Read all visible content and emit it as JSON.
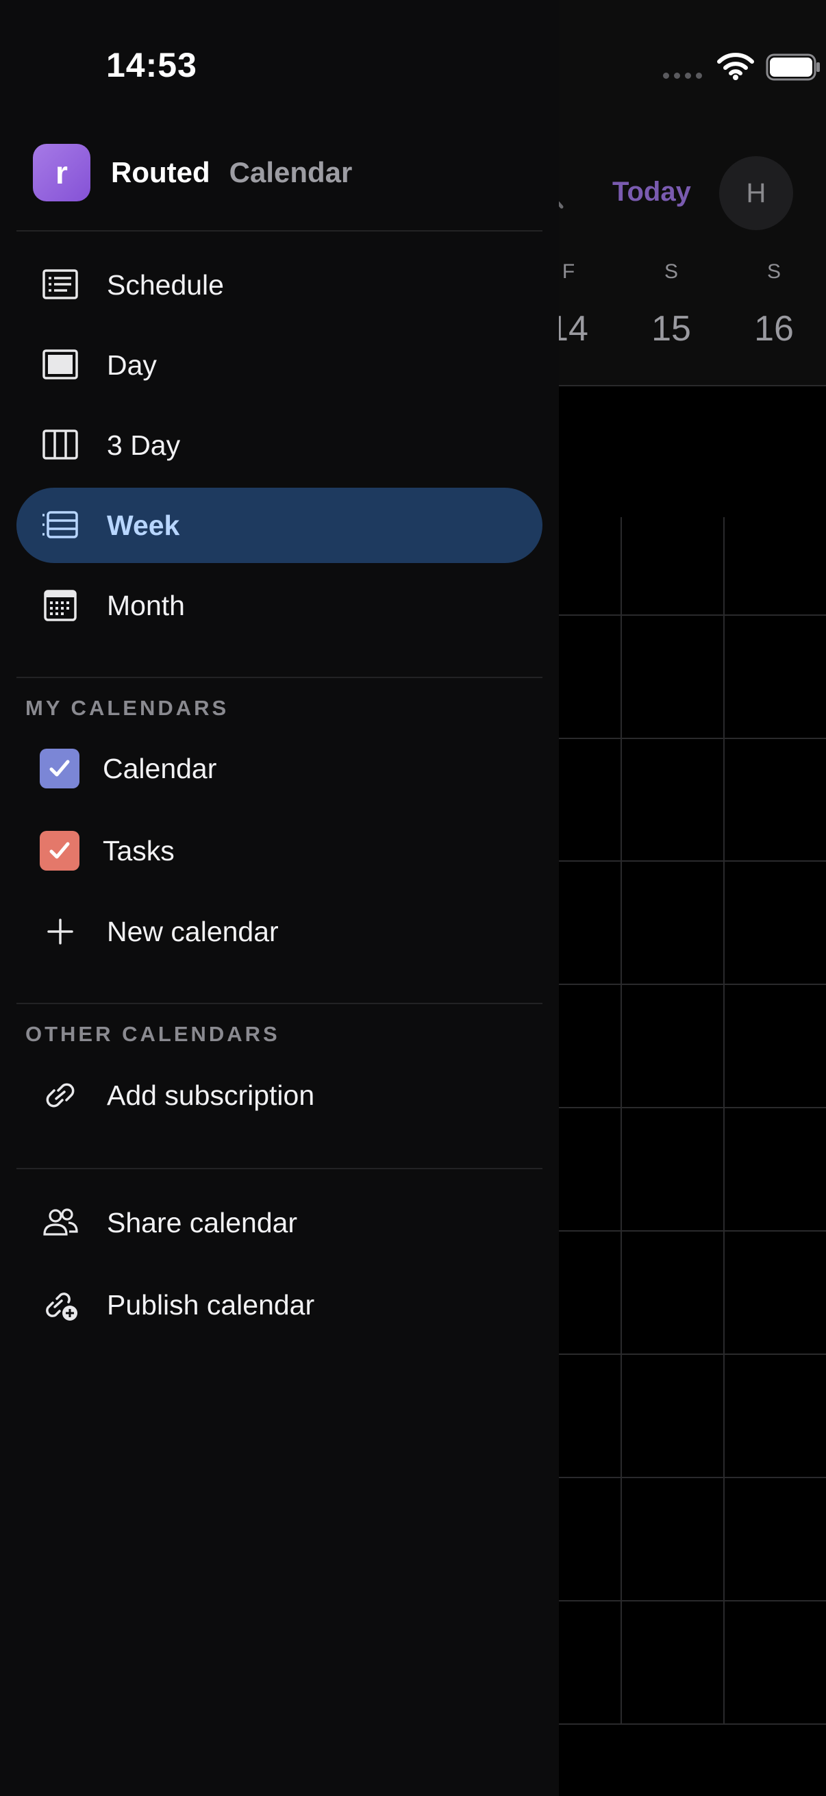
{
  "status_bar": {
    "time": "14:53"
  },
  "brand": {
    "logo_letter": "r",
    "name": "Routed",
    "subtitle": "Calendar",
    "logo_color": "#9b6be0"
  },
  "nav": {
    "items": [
      {
        "label": "Schedule",
        "icon": "schedule-list-icon"
      },
      {
        "label": "Day",
        "icon": "day-view-icon"
      },
      {
        "label": "3 Day",
        "icon": "three-day-view-icon"
      },
      {
        "label": "Week",
        "icon": "week-view-icon",
        "active": true
      },
      {
        "label": "Month",
        "icon": "month-view-icon"
      }
    ]
  },
  "my_calendars": {
    "heading": "MY CALENDARS",
    "items": [
      {
        "label": "Calendar",
        "checked": true,
        "color": "#7b86d6"
      },
      {
        "label": "Tasks",
        "checked": true,
        "color": "#e4786a"
      }
    ],
    "new_label": "New calendar"
  },
  "other_calendars": {
    "heading": "OTHER CALENDARS",
    "add_subscription_label": "Add subscription"
  },
  "actions": {
    "share_label": "Share calendar",
    "publish_label": "Publish calendar"
  },
  "background_calendar": {
    "today_label": "Today",
    "avatar_letter": "H",
    "days": [
      {
        "dow": "F",
        "date": "14"
      },
      {
        "dow": "S",
        "date": "15"
      },
      {
        "dow": "S",
        "date": "16"
      }
    ],
    "accent_color": "#7a5bb0"
  },
  "colors": {
    "active_nav_bg": "#1e3a5f",
    "active_nav_text": "#b8d6ff",
    "drawer_bg": "#0c0c0d"
  }
}
